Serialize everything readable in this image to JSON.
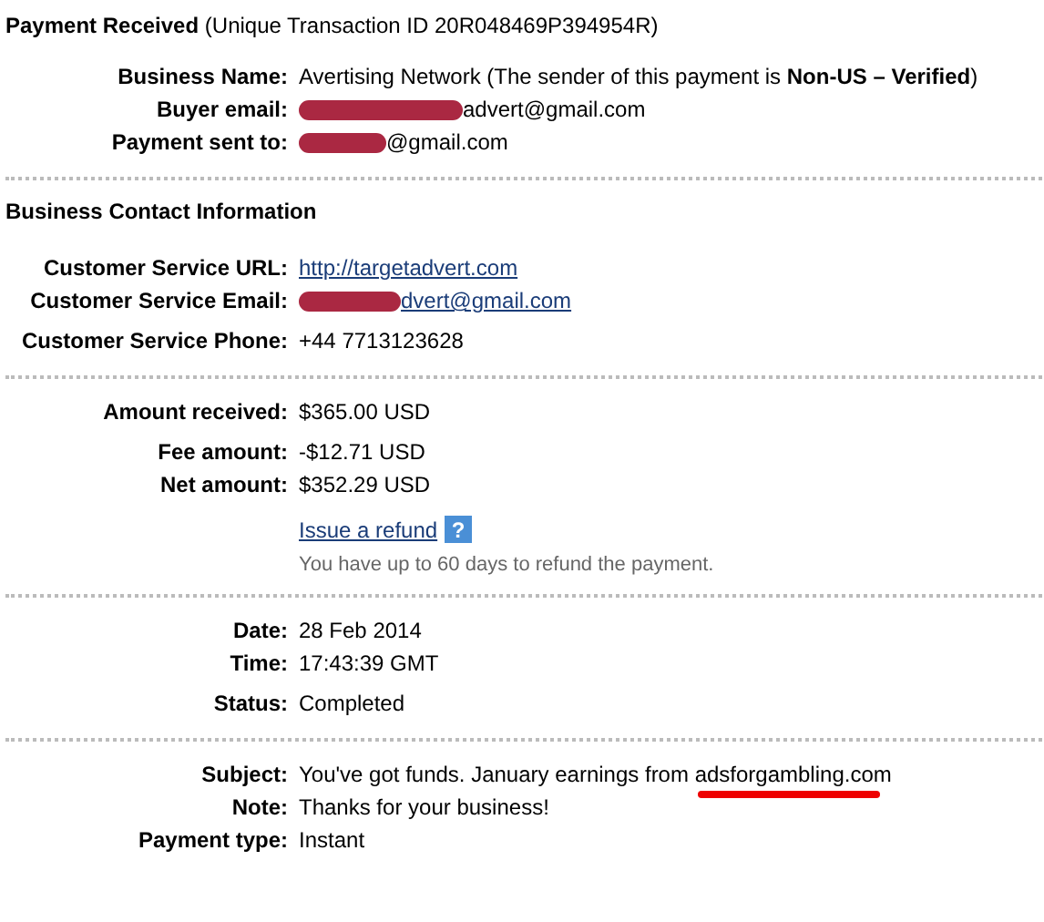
{
  "header": {
    "title": "Payment Received",
    "transaction": "(Unique Transaction ID 20R048469P394954R)"
  },
  "sections": [
    {
      "groups": [
        {
          "rows": [
            {
              "label": "Business Name:",
              "kind": "text",
              "value": "Avertising Network (The sender of this payment is **Non-US – Verified**)"
            },
            {
              "label": "Buyer email:",
              "kind": "redacted",
              "value": "advert@gmail.com"
            },
            {
              "label": "Payment sent to:",
              "kind": "redacted",
              "value": "@gmail.com"
            }
          ]
        }
      ]
    },
    {
      "heading": "Business Contact Information",
      "groups": [
        {
          "rows": [
            {
              "label": "Customer Service URL:",
              "kind": "link",
              "value": "http://targetadvert.com"
            },
            {
              "label": "Customer Service Email:",
              "kind": "redacted_link",
              "value": "dvert@gmail.com"
            }
          ]
        },
        {
          "rows": [
            {
              "label": "Customer Service Phone:",
              "kind": "text",
              "value": "+44 7713123628"
            }
          ]
        }
      ]
    },
    {
      "groups": [
        {
          "rows": [
            {
              "label": "Amount received:",
              "kind": "text",
              "value": "$365.00 USD"
            }
          ]
        },
        {
          "rows": [
            {
              "label": "Fee amount:",
              "kind": "text",
              "value": "-$12.71 USD"
            },
            {
              "label": "Net amount:",
              "kind": "text",
              "value": "$352.29 USD"
            }
          ]
        }
      ],
      "refund": {
        "link": "Issue a refund",
        "help": "?",
        "note": "You have up to 60 days to refund the payment."
      }
    },
    {
      "groups": [
        {
          "rows": [
            {
              "label": "Date:",
              "kind": "text",
              "value": "28 Feb 2014"
            },
            {
              "label": "Time:",
              "kind": "text",
              "value": "17:43:39 GMT"
            }
          ]
        },
        {
          "rows": [
            {
              "label": "Status:",
              "kind": "text",
              "value": "Completed"
            }
          ]
        }
      ]
    },
    {
      "groups": [
        {
          "rows": [
            {
              "label": "Subject:",
              "kind": "underlined",
              "value": "You've got funds. January earnings from ",
              "marked": "adsforgambling.com"
            },
            {
              "label": "Note:",
              "kind": "text",
              "value": "Thanks for your business!"
            },
            {
              "label": "Payment type:",
              "kind": "text",
              "value": "Instant"
            }
          ]
        }
      ]
    }
  ]
}
